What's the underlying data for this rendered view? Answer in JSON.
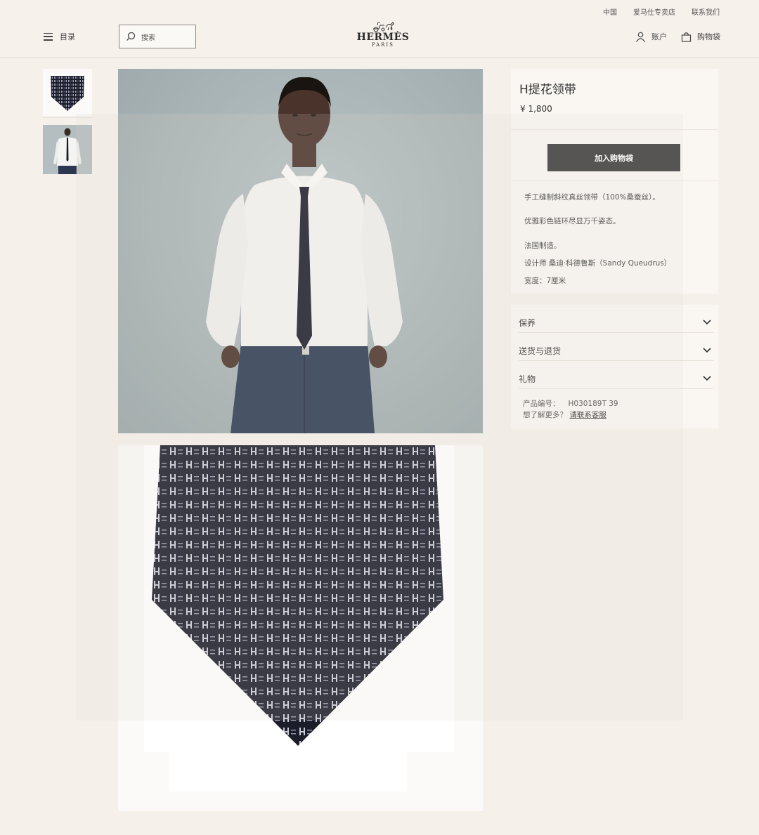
{
  "header": {
    "top_links": [
      "中国",
      "爱马仕专卖店",
      "联系我们"
    ],
    "menu_label": "目录",
    "search_placeholder": "搜索",
    "logo_brand": "HERMÈS",
    "logo_city": "PARIS",
    "account_label": "账户",
    "bag_label": "购物袋"
  },
  "icons": {
    "menu": "menu-icon",
    "search": "search-icon",
    "account": "user-icon",
    "bag": "shopping-bag-icon",
    "chevron": "chevron-down-icon"
  },
  "product": {
    "title": "H提花领带",
    "price": "¥ 1,800",
    "add_to_bag": "加入购物袋",
    "description": [
      "手工缝制斜纹真丝领带（100%桑蚕丝）。",
      "优雅彩色链环尽显万千姿态。",
      "法国制造。",
      "设计师 桑迪·科德鲁斯（Sandy Queudrus）",
      "宽度：7厘米"
    ],
    "accordion": [
      "保养",
      "送货与退货",
      "礼物"
    ],
    "product_code_label": "产品编号：",
    "product_code": "H030189T 39",
    "more_question": "想了解更多？",
    "contact_link": "请联系客服"
  },
  "colors": {
    "background": "#f5f0ea",
    "button": "#3c3c3c",
    "tie": "#1c1d2b"
  }
}
